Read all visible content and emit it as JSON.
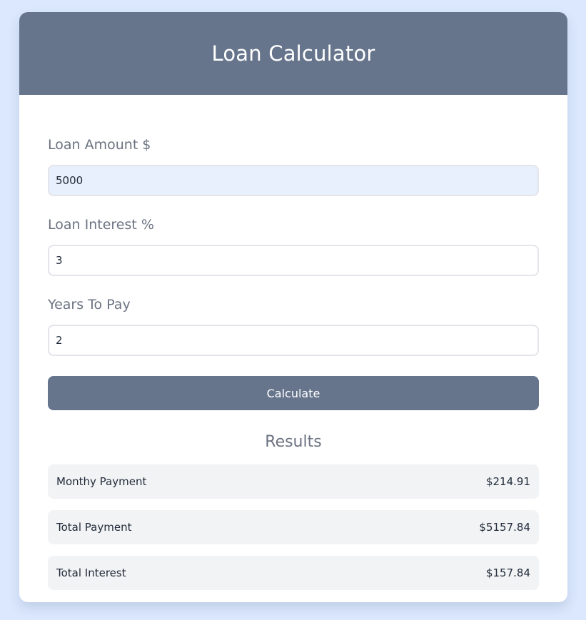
{
  "header": {
    "title": "Loan Calculator"
  },
  "form": {
    "amount": {
      "label": "Loan Amount $",
      "value": "5000"
    },
    "interest": {
      "label": "Loan Interest %",
      "value": "3"
    },
    "years": {
      "label": "Years To Pay",
      "value": "2"
    },
    "button_label": "Calculate"
  },
  "results": {
    "title": "Results",
    "rows": [
      {
        "label": "Monthy Payment",
        "value": "$214.91"
      },
      {
        "label": "Total Payment",
        "value": "$5157.84"
      },
      {
        "label": "Total Interest",
        "value": "$157.84"
      }
    ]
  },
  "colors": {
    "background": "#dbe8fd",
    "header": "#66758c",
    "button": "#66758c",
    "result_row": "#f2f3f5",
    "filled_input": "#e8f0fd"
  }
}
